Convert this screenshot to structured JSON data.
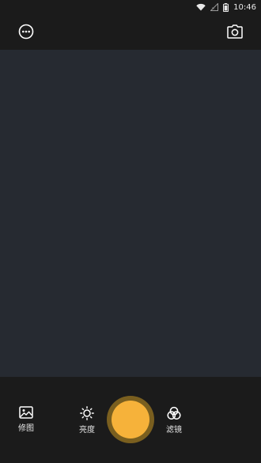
{
  "status_bar": {
    "time": "10:46",
    "icons": [
      "wifi-icon",
      "signal-icon",
      "battery-icon"
    ]
  },
  "top_bar": {
    "left_icon": "more-icon",
    "right_icon": "camera-switch-icon"
  },
  "bottom_bar": {
    "tools": [
      {
        "label": "修图",
        "icon": "image-edit-icon"
      },
      {
        "label": "亮度",
        "icon": "brightness-icon"
      },
      {
        "label": "滤镜",
        "icon": "filter-icon"
      }
    ],
    "shutter_icon": "shutter-button"
  },
  "colors": {
    "background": "#1b1b1b",
    "viewfinder": "#262a31",
    "accent": "#f6b23a",
    "shutter_ring": "#7a5f1f",
    "text": "#e6e6e6"
  }
}
